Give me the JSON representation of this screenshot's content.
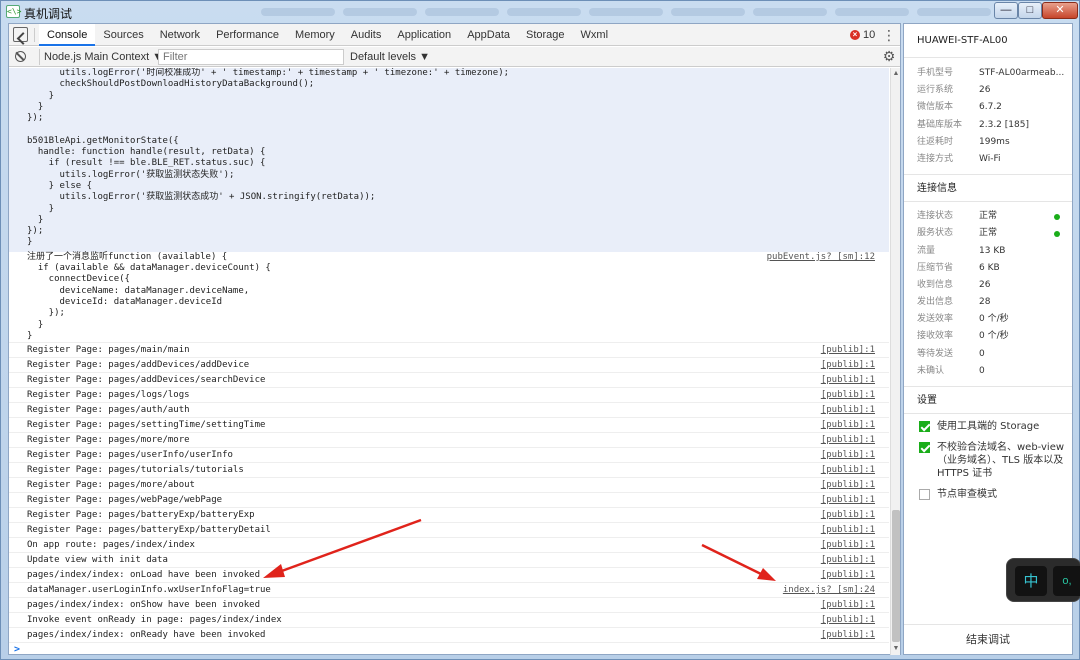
{
  "window": {
    "title": "真机调试",
    "app_icon": "<\\>",
    "buttons": {
      "minimize": "—",
      "maximize": "□",
      "close": "✕"
    }
  },
  "devtools": {
    "tabs": [
      "Console",
      "Sources",
      "Network",
      "Performance",
      "Memory",
      "Audits",
      "Application",
      "AppData",
      "Storage",
      "Wxml"
    ],
    "active_tab": "Console",
    "error_count": "10",
    "context_selector": "Node.js Main Context ▼",
    "filter_placeholder": "Filter",
    "levels": "Default levels ▼",
    "prompt": ">"
  },
  "console": {
    "code_block_1": "      utils.logError('时间校准成功' + ' timestamp:' + timestamp + ' timezone:' + timezone);\n      checkShouldPostDownloadHistoryDataBackground();\n    }\n  }\n});\n\nb501BleApi.getMonitorState({\n  handle: function handle(result, retData) {\n    if (result !== ble.BLE_RET.status.suc) {\n      utils.logError('获取监测状态失败');\n    } else {\n      utils.logError('获取监测状态成功' + JSON.stringify(retData));\n    }\n  }\n});\n}",
    "message_2": "注册了一个消息监听function (available) {\n  if (available && dataManager.deviceCount) {\n    connectDevice({\n      deviceName: dataManager.deviceName,\n      deviceId: dataManager.deviceId\n    });\n  }\n}",
    "message_2_source": "pubEvent.js? [sm]:12",
    "logs": [
      {
        "text": "Register Page: pages/main/main",
        "source": "[publib]:1"
      },
      {
        "text": "Register Page: pages/addDevices/addDevice",
        "source": "[publib]:1"
      },
      {
        "text": "Register Page: pages/addDevices/searchDevice",
        "source": "[publib]:1"
      },
      {
        "text": "Register Page: pages/logs/logs",
        "source": "[publib]:1"
      },
      {
        "text": "Register Page: pages/auth/auth",
        "source": "[publib]:1"
      },
      {
        "text": "Register Page: pages/settingTime/settingTime",
        "source": "[publib]:1"
      },
      {
        "text": "Register Page: pages/more/more",
        "source": "[publib]:1"
      },
      {
        "text": "Register Page: pages/userInfo/userInfo",
        "source": "[publib]:1"
      },
      {
        "text": "Register Page: pages/tutorials/tutorials",
        "source": "[publib]:1"
      },
      {
        "text": "Register Page: pages/more/about",
        "source": "[publib]:1"
      },
      {
        "text": "Register Page: pages/webPage/webPage",
        "source": "[publib]:1"
      },
      {
        "text": "Register Page: pages/batteryExp/batteryExp",
        "source": "[publib]:1"
      },
      {
        "text": "Register Page: pages/batteryExp/batteryDetail",
        "source": "[publib]:1"
      },
      {
        "text": "On app route: pages/index/index",
        "source": "[publib]:1"
      },
      {
        "text": "Update view with init data",
        "source": "[publib]:1"
      },
      {
        "text": "pages/index/index: onLoad have been invoked",
        "source": "[publib]:1"
      },
      {
        "text": "dataManager.userLoginInfo.wxUserInfoFlag=true",
        "source": "index.js? [sm]:24"
      },
      {
        "text": "pages/index/index: onShow have been invoked",
        "source": "[publib]:1"
      },
      {
        "text": "Invoke event onReady in page: pages/index/index",
        "source": "[publib]:1"
      },
      {
        "text": "pages/index/index: onReady have been invoked",
        "source": "[publib]:1"
      }
    ]
  },
  "panel": {
    "device": "HUAWEI-STF-AL00",
    "info": [
      {
        "k": "手机型号",
        "v": "STF-AL00armeab..."
      },
      {
        "k": "运行系统",
        "v": "26"
      },
      {
        "k": "微信版本",
        "v": "6.7.2"
      },
      {
        "k": "基础库版本",
        "v": "2.3.2 [185]"
      },
      {
        "k": "往返耗时",
        "v": "199ms"
      },
      {
        "k": "连接方式",
        "v": "Wi-Fi"
      }
    ],
    "conn_title": "连接信息",
    "conn": [
      {
        "k": "连接状态",
        "v": "正常",
        "dot": true
      },
      {
        "k": "服务状态",
        "v": "正常",
        "dot": true
      },
      {
        "k": "流量",
        "v": "13 KB"
      },
      {
        "k": "压缩节省",
        "v": "6 KB"
      },
      {
        "k": "收到信息",
        "v": "26"
      },
      {
        "k": "发出信息",
        "v": "28"
      },
      {
        "k": "发送效率",
        "v": "0 个/秒"
      },
      {
        "k": "接收效率",
        "v": "0 个/秒"
      },
      {
        "k": "等待发送",
        "v": "0"
      },
      {
        "k": "未确认",
        "v": "0"
      }
    ],
    "settings_title": "设置",
    "settings": [
      {
        "label": "使用工具端的 Storage",
        "checked": true
      },
      {
        "label": "不校验合法域名、web-view（业务域名）、TLS 版本以及 HTTPS 证书",
        "checked": true
      },
      {
        "label": "节点审查模式",
        "checked": false
      }
    ],
    "footer": "结束调试"
  },
  "ime": {
    "key1": "中",
    "key2": "o,"
  },
  "colors": {
    "accent": "#1a73e8",
    "ok_dot": "#1aad19",
    "checkbox": "#1aad19",
    "arrow": "#e0231b",
    "code_bg": "#e9eef9"
  }
}
